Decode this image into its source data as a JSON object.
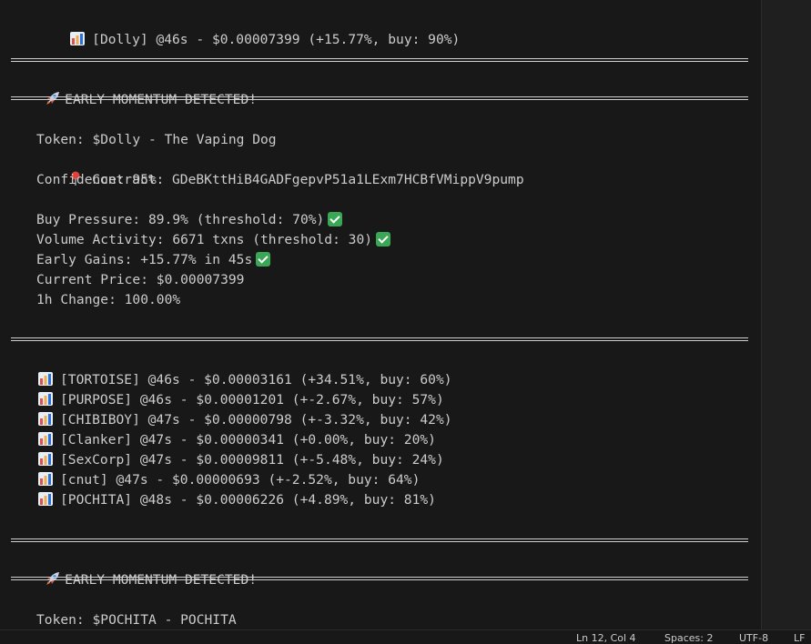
{
  "lines": {
    "dolly_line": "[Dolly] @46s - $0.00007399 (+15.77%, buy: 90%)",
    "alert1_title": "EARLY MOMENTUM DETECTED!",
    "alert1": {
      "token": "Token: $Dolly - The Vaping Dog",
      "contract": "Contract: GDeBKttHiB4GADFgepvP51a1LExm7HCBfVMippV9pump",
      "confidence": "Confidence: 95%",
      "buy_pressure": "Buy Pressure: 89.9% (threshold: 70%)",
      "volume": "Volume Activity: 6671 txns (threshold: 30)",
      "gains": "Early Gains: +15.77% in 45s",
      "price": "Current Price: $0.00007399",
      "change": "1h Change: 100.00%"
    },
    "ticks": [
      "[TORTOISE] @46s - $0.00003161 (+34.51%, buy: 60%)",
      "[PURPOSE] @46s - $0.00001201 (+-2.67%, buy: 57%)",
      "[CHIBIBOY] @47s - $0.00000798 (+-3.32%, buy: 42%)",
      "[Clanker] @47s - $0.00000341 (+0.00%, buy: 20%)",
      "[SexCorp] @47s - $0.00009811 (+-5.48%, buy: 24%)",
      "[cnut] @47s - $0.00000693 (+-2.52%, buy: 64%)",
      "[POCHITA] @48s - $0.00006226 (+4.89%, buy: 81%)"
    ],
    "alert2_title": "EARLY MOMENTUM DETECTED!",
    "alert2_token": "Token: $POCHITA - POCHITA"
  },
  "icons": {
    "chart": "bar-chart-icon",
    "rocket": "rocket-icon",
    "pin": "pin-icon",
    "check": "check-mark-icon"
  },
  "statusbar": {
    "position": "Ln 12, Col 4",
    "spaces": "Spaces: 2",
    "encoding": "UTF-8",
    "eol": "LF"
  },
  "colors": {
    "background": "#181818",
    "text": "#cccccc",
    "check": "#3aa757"
  }
}
